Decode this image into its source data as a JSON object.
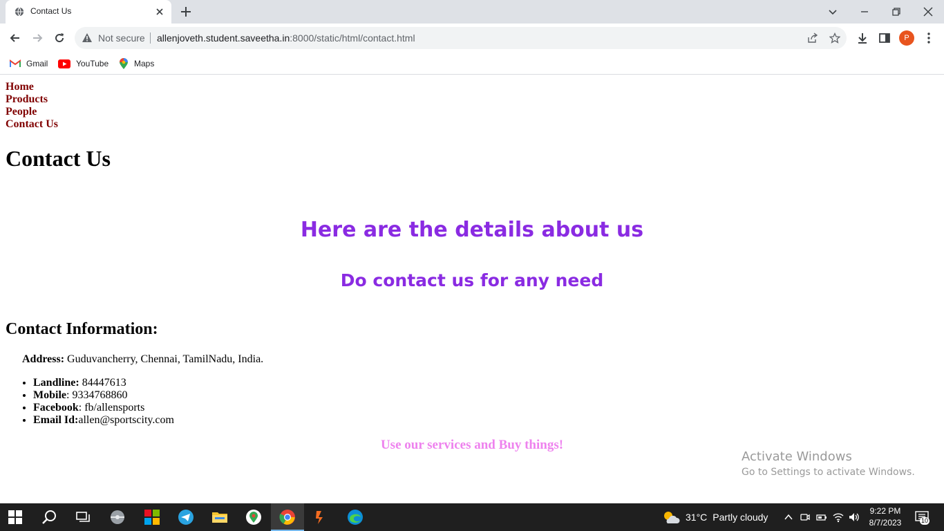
{
  "browser": {
    "tab": {
      "title": "Contact Us"
    },
    "address": {
      "security_label": "Not secure",
      "host": "allenjoveth.student.saveetha.in",
      "path": ":8000/static/html/contact.html"
    },
    "profile_initial": "P",
    "bookmarks": [
      {
        "label": "Gmail"
      },
      {
        "label": "YouTube"
      },
      {
        "label": "Maps"
      }
    ]
  },
  "page": {
    "nav": [
      "Home",
      "Products",
      "People",
      "Contact Us"
    ],
    "title": "Contact Us",
    "headline": "Here are the details about us",
    "subheadline": "Do contact us for any need",
    "contact_title": "Contact Information:",
    "address_label": "Address:",
    "address_value": " Guduvancherry, Chennai, TamilNadu, India.",
    "contacts": [
      {
        "label": "Landline:",
        "value": " 84447613"
      },
      {
        "label": "Mobile",
        "value": ": 9334768860"
      },
      {
        "label": "Facebook",
        "value": ": fb/allensports"
      },
      {
        "label": "Email Id:",
        "value": "allen@sportscity.com"
      }
    ],
    "footer": "Use our services and Buy things!"
  },
  "watermark": {
    "line1": "Activate Windows",
    "line2": "Go to Settings to activate Windows."
  },
  "taskbar": {
    "weather_temp": "31°C",
    "weather_desc": "Partly cloudy",
    "time": "9:22 PM",
    "date": "8/7/2023",
    "notification_count": "10"
  },
  "colors": {
    "nav_link": "#800000",
    "headline": "#8a2be2",
    "footer": "#ee82ee"
  }
}
